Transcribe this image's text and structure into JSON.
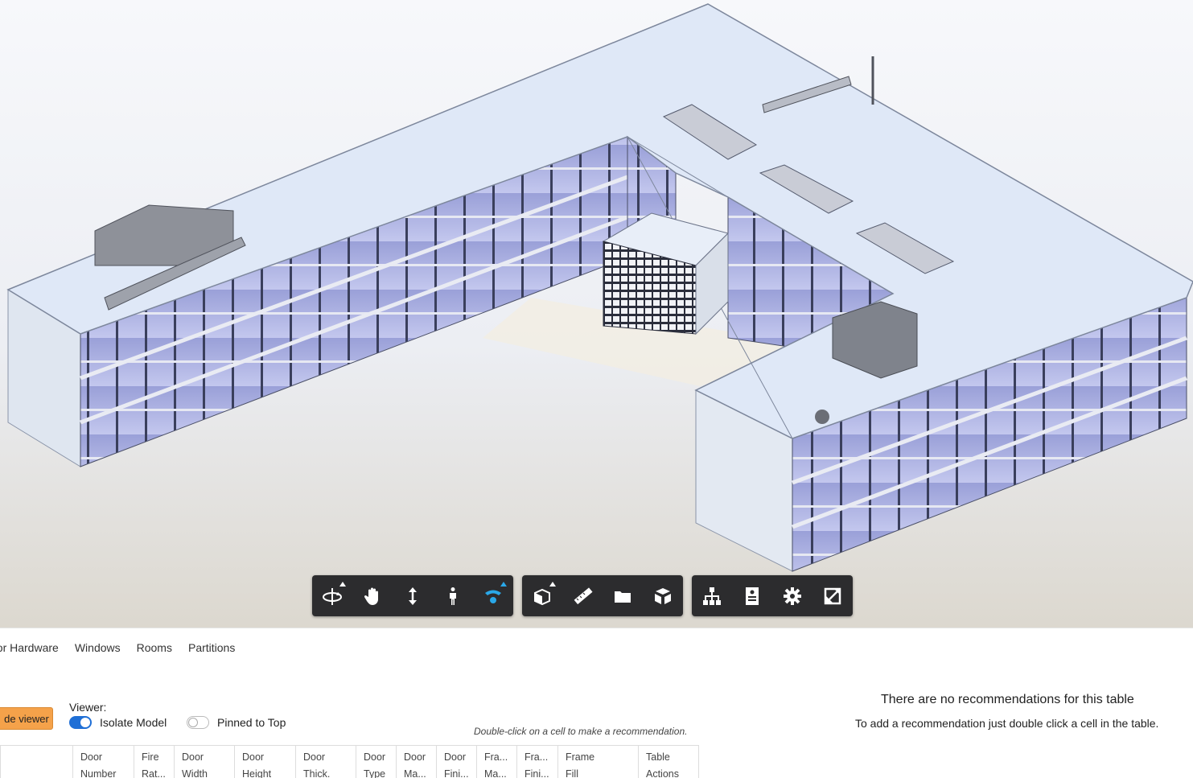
{
  "toolbar": {
    "navigation": [
      {
        "name": "orbit-icon",
        "has_flyout": true
      },
      {
        "name": "pan-icon",
        "has_flyout": false
      },
      {
        "name": "zoom-icon",
        "has_flyout": false
      },
      {
        "name": "first-person-icon",
        "has_flyout": false
      },
      {
        "name": "camera-view-icon",
        "has_flyout": true,
        "active": true
      }
    ],
    "modeling": [
      {
        "name": "section-icon",
        "has_flyout": true
      },
      {
        "name": "measure-icon",
        "has_flyout": false
      },
      {
        "name": "model-browser-icon",
        "has_flyout": false
      },
      {
        "name": "explode-icon",
        "has_flyout": false
      }
    ],
    "settings": [
      {
        "name": "structure-icon"
      },
      {
        "name": "properties-icon"
      },
      {
        "name": "settings-gear-icon"
      },
      {
        "name": "fullscreen-icon"
      }
    ]
  },
  "tabs": [
    "oor Hardware",
    "Windows",
    "Rooms",
    "Partitions"
  ],
  "controls": {
    "hide_viewer_label": "de viewer",
    "viewer_label": "Viewer:",
    "isolate_model": {
      "label": "Isolate Model",
      "on": true
    },
    "pinned_to_top": {
      "label": "Pinned to Top",
      "on": false
    },
    "hint": "Double-click on a cell to make a recommendation."
  },
  "recommendations": {
    "title": "There are no recommendations for this table",
    "subtitle": "To add a recommendation just double click a cell in the table."
  },
  "table": {
    "columns": [
      [
        "",
        ""
      ],
      [
        "Door",
        "Number"
      ],
      [
        "Fire",
        "Rat..."
      ],
      [
        "Door",
        "Width"
      ],
      [
        "Door",
        "Height"
      ],
      [
        "Door",
        "Thick."
      ],
      [
        "Door",
        "Type"
      ],
      [
        "Door",
        "Ma..."
      ],
      [
        "Door",
        "Fini..."
      ],
      [
        "Fra...",
        "Ma..."
      ],
      [
        "Fra...",
        "Fini..."
      ],
      [
        "Frame",
        "Fill"
      ],
      [
        "Table",
        "Actions"
      ]
    ]
  },
  "colors": {
    "toolbar_bg": "#2c2c2e",
    "accent_blue": "#2aa8e8",
    "toggle_on": "#1f6fd6",
    "hide_button": "#f5a24a"
  }
}
